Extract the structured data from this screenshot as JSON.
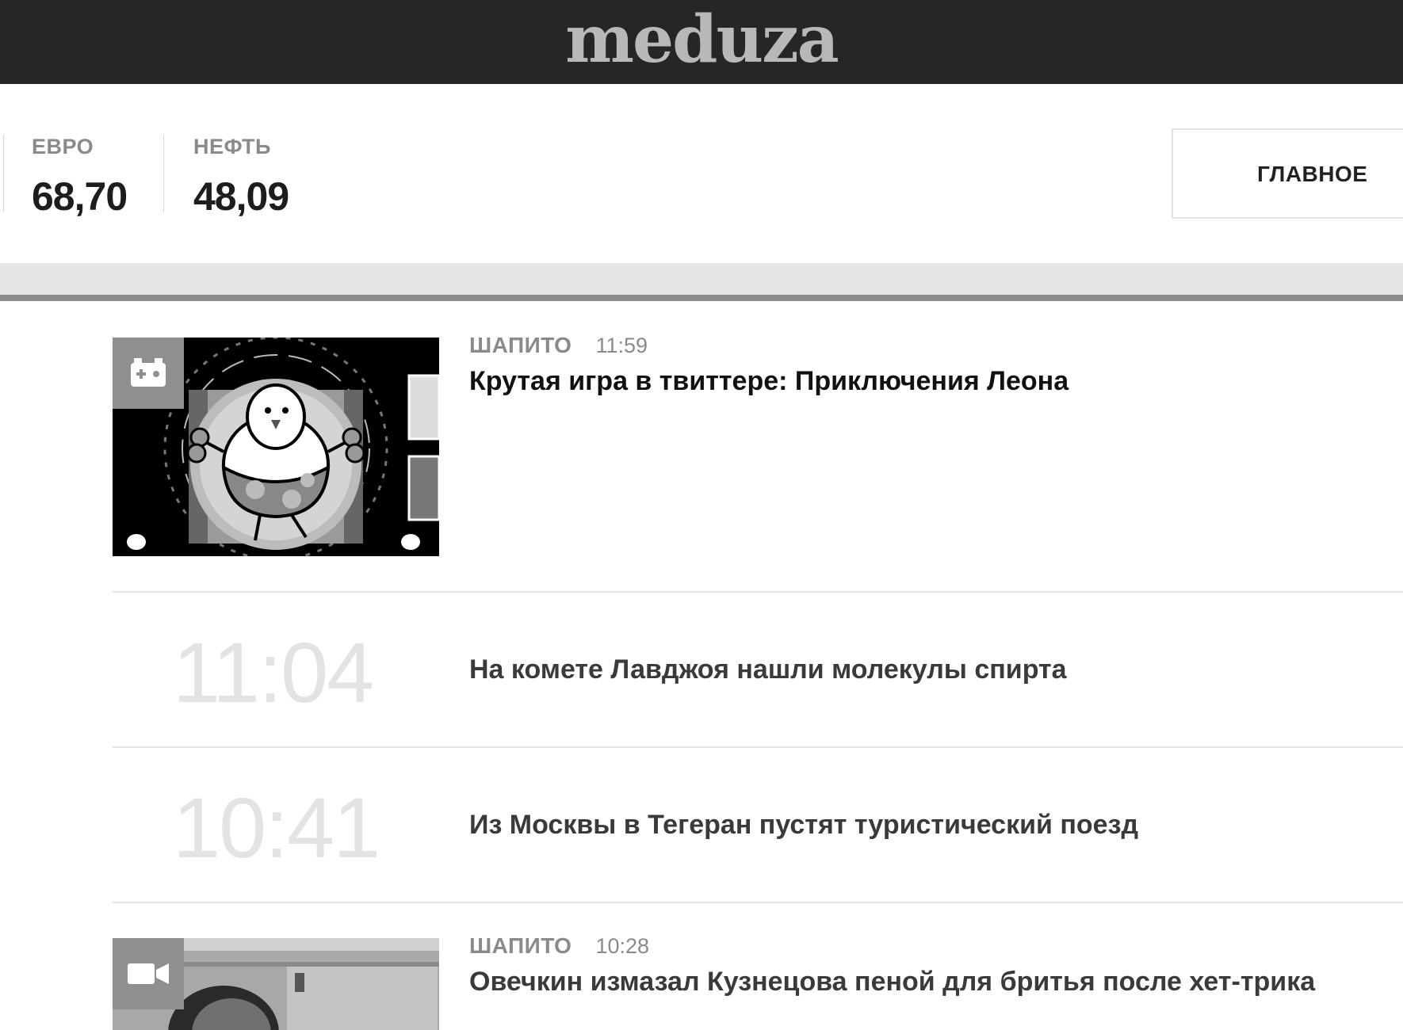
{
  "header": {
    "logo": "meduza"
  },
  "rates": [
    {
      "label": "ЕВРО",
      "value": "68,70"
    },
    {
      "label": "НЕФТЬ",
      "value": "48,09"
    }
  ],
  "nav": {
    "main_label": "ГЛАВНОЕ"
  },
  "feed": [
    {
      "tag": "ШАПИТО",
      "time": "11:59",
      "title": "Крутая игра в твиттере: Приключения Леона",
      "badge_icon": "gamepad-icon"
    },
    {
      "big_time": "11:04",
      "title": "На комете Лавджоя нашли молекулы спирта"
    },
    {
      "big_time": "10:41",
      "title": "Из Москвы в Тегеран пустят туристический поезд"
    },
    {
      "tag": "ШАПИТО",
      "time": "10:28",
      "title": "Овечкин измазал Кузнецова пеной для бритья после хет-трика",
      "badge_icon": "video-camera-icon"
    }
  ]
}
